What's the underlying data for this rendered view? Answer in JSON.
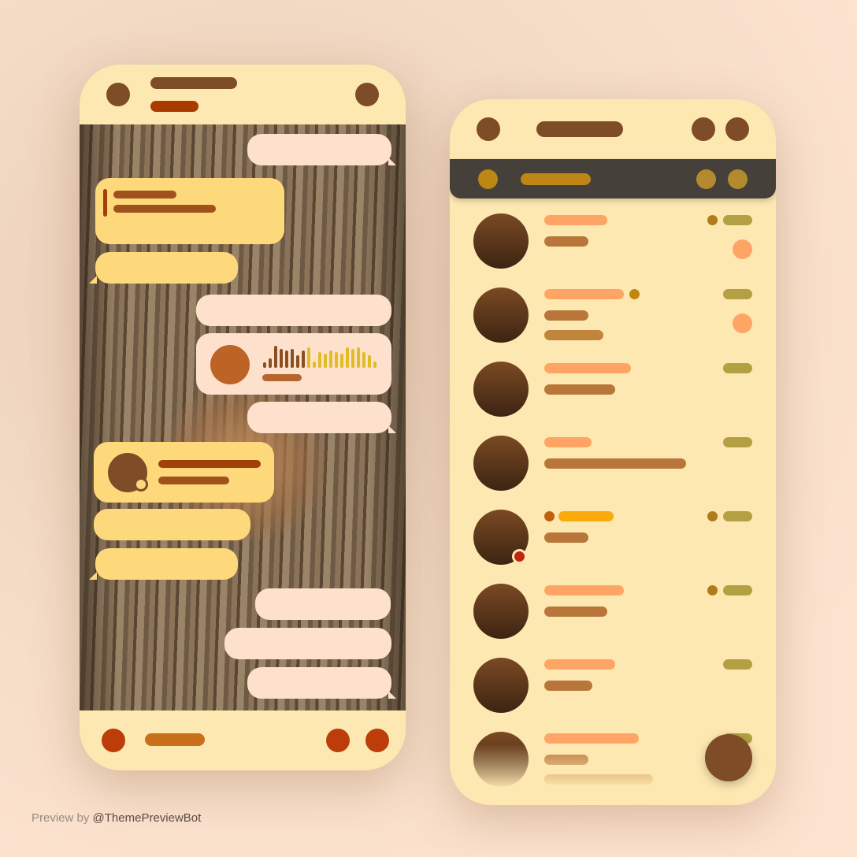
{
  "credit": {
    "prefix": "Preview by",
    "handle": "@ThemePreviewBot"
  },
  "colors": {
    "background": "#fde3cf",
    "header": "#fee8b2",
    "accent": "#7e4c27",
    "incoming_bubble": "#fee1cc",
    "outgoing_bubble": "#fed97c",
    "dark_bar": "#45413a",
    "unread_badge": "#fea566",
    "online": "#c0230f"
  },
  "chat_list": {
    "rows": 8
  }
}
